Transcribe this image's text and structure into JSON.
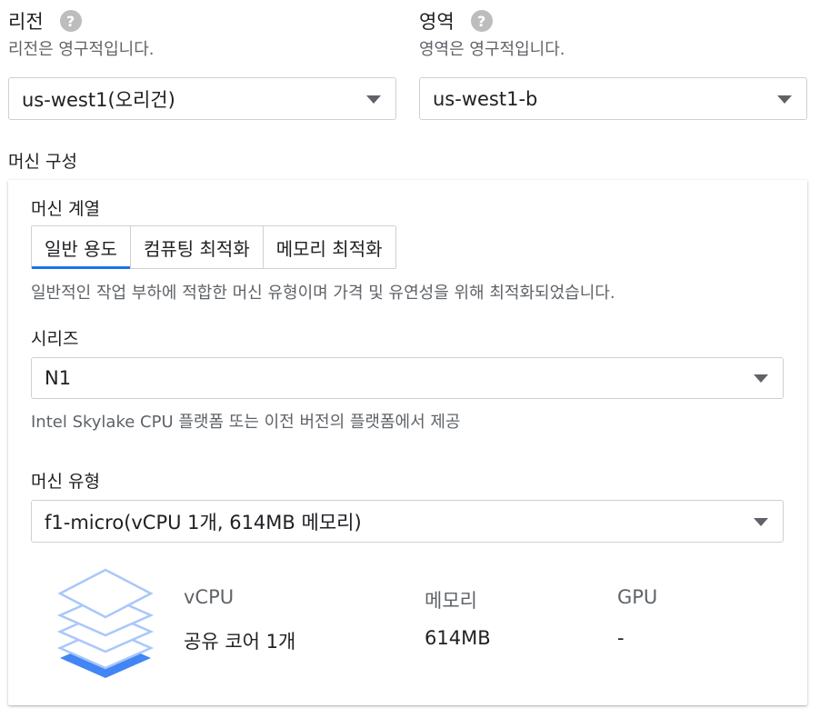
{
  "region": {
    "label": "리전",
    "hint": "리전은 영구적입니다.",
    "value": "us-west1(오리건)"
  },
  "zone": {
    "label": "영역",
    "hint": "영역은 영구적입니다.",
    "value": "us-west1-b"
  },
  "help_glyph": "?",
  "machine_config": {
    "title": "머신 구성",
    "family_label": "머신 계열",
    "tabs": [
      {
        "label": "일반 용도",
        "active": true
      },
      {
        "label": "컴퓨팅 최적화",
        "active": false
      },
      {
        "label": "메모리 최적화",
        "active": false
      }
    ],
    "family_hint": "일반적인 작업 부하에 적합한 머신 유형이며 가격 및 유연성을 위해 최적화되었습니다.",
    "series": {
      "label": "시리즈",
      "value": "N1",
      "hint": "Intel Skylake CPU 플랫폼 또는 이전 버전의 플랫폼에서 제공"
    },
    "machine_type": {
      "label": "머신 유형",
      "value": "f1-micro(vCPU 1개, 614MB 메모리)"
    },
    "specs": {
      "vcpu_label": "vCPU",
      "vcpu_value": "공유 코어 1개",
      "memory_label": "메모리",
      "memory_value": "614MB",
      "gpu_label": "GPU",
      "gpu_value": "-"
    }
  },
  "colors": {
    "accent": "#1a73e8",
    "stack_icon_light": "#a8c7fa",
    "stack_icon_dark": "#4285f4"
  }
}
